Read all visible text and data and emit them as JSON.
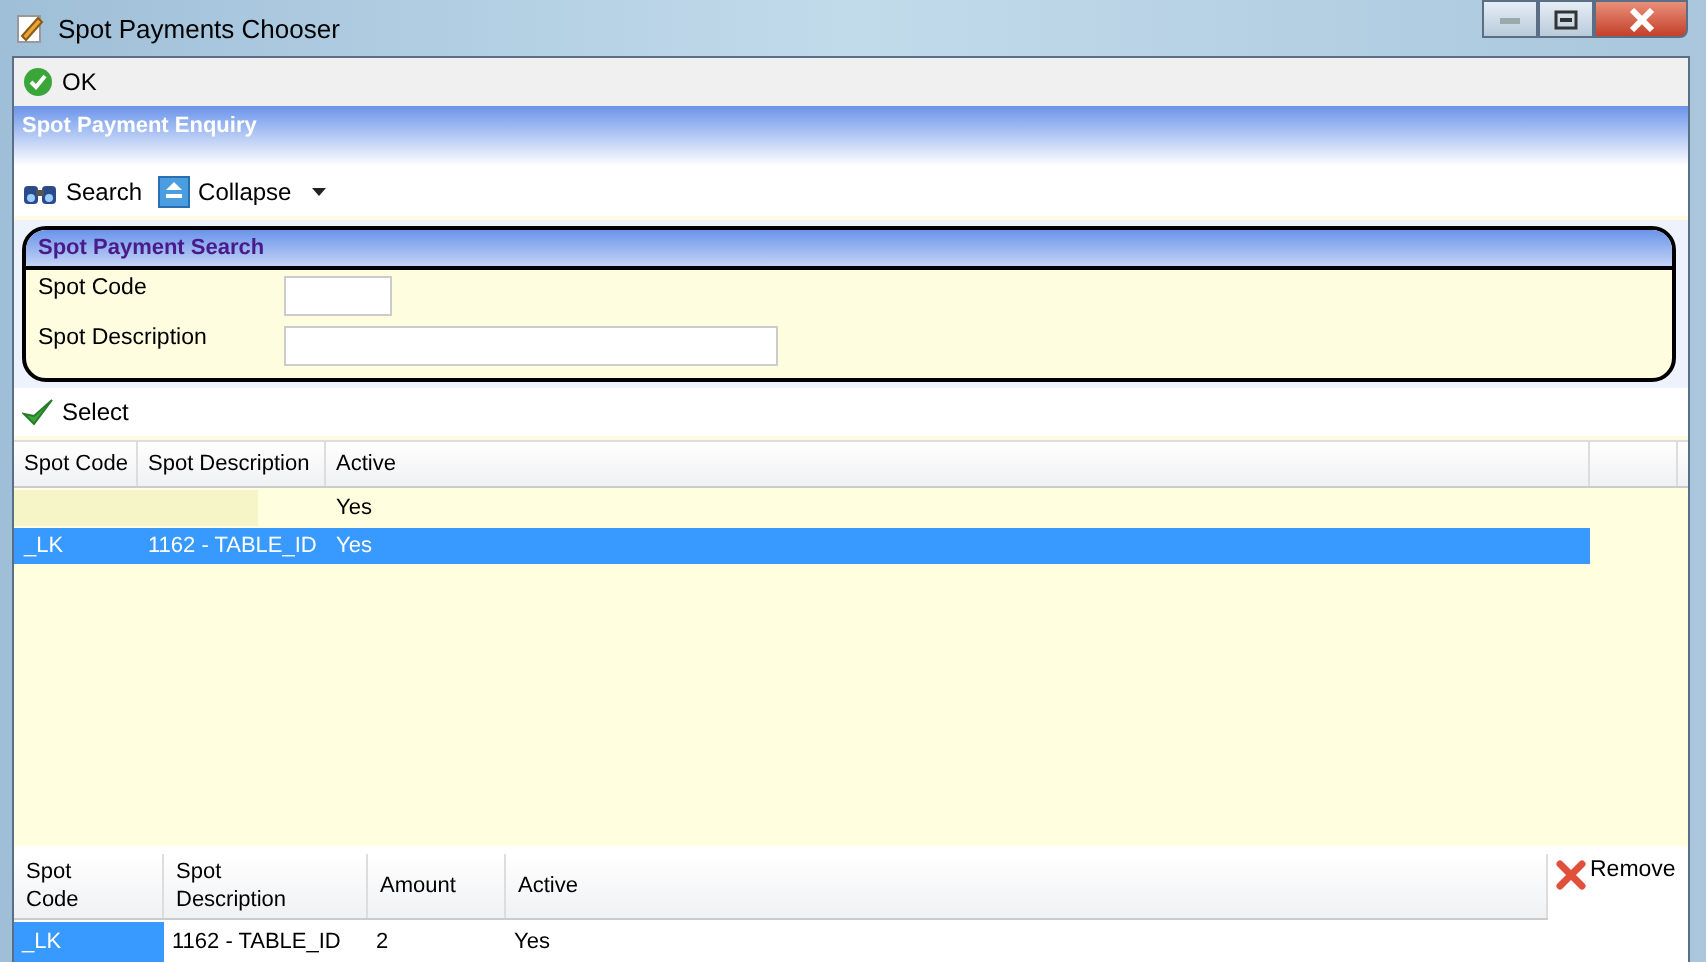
{
  "window": {
    "title": "Spot Payments Chooser"
  },
  "ok_button": "OK",
  "section_title": "Spot Payment Enquiry",
  "toolbar": {
    "search": "Search",
    "collapse": "Collapse"
  },
  "search_group": {
    "title": "Spot Payment Search",
    "fields": [
      {
        "label": "Spot Code",
        "kind": "short"
      },
      {
        "label": "Spot Description",
        "kind": "long"
      }
    ]
  },
  "select_button": "Select",
  "results": {
    "columns": [
      "Spot Code",
      "Spot Description",
      "Active"
    ],
    "rows": [
      {
        "active": "Yes",
        "selected": false
      },
      {
        "code": "_LK",
        "description": "1162 - TABLE_ID",
        "active": "Yes",
        "selected": true
      }
    ]
  },
  "chosen": {
    "columns": [
      "Spot Code",
      "Spot Description",
      "Amount",
      "Active"
    ],
    "remove_button": "Remove",
    "rows": [
      {
        "code": "_LK",
        "description": "1162 - TABLE_ID",
        "amount": "2",
        "active": "Yes",
        "selected": true
      }
    ]
  }
}
